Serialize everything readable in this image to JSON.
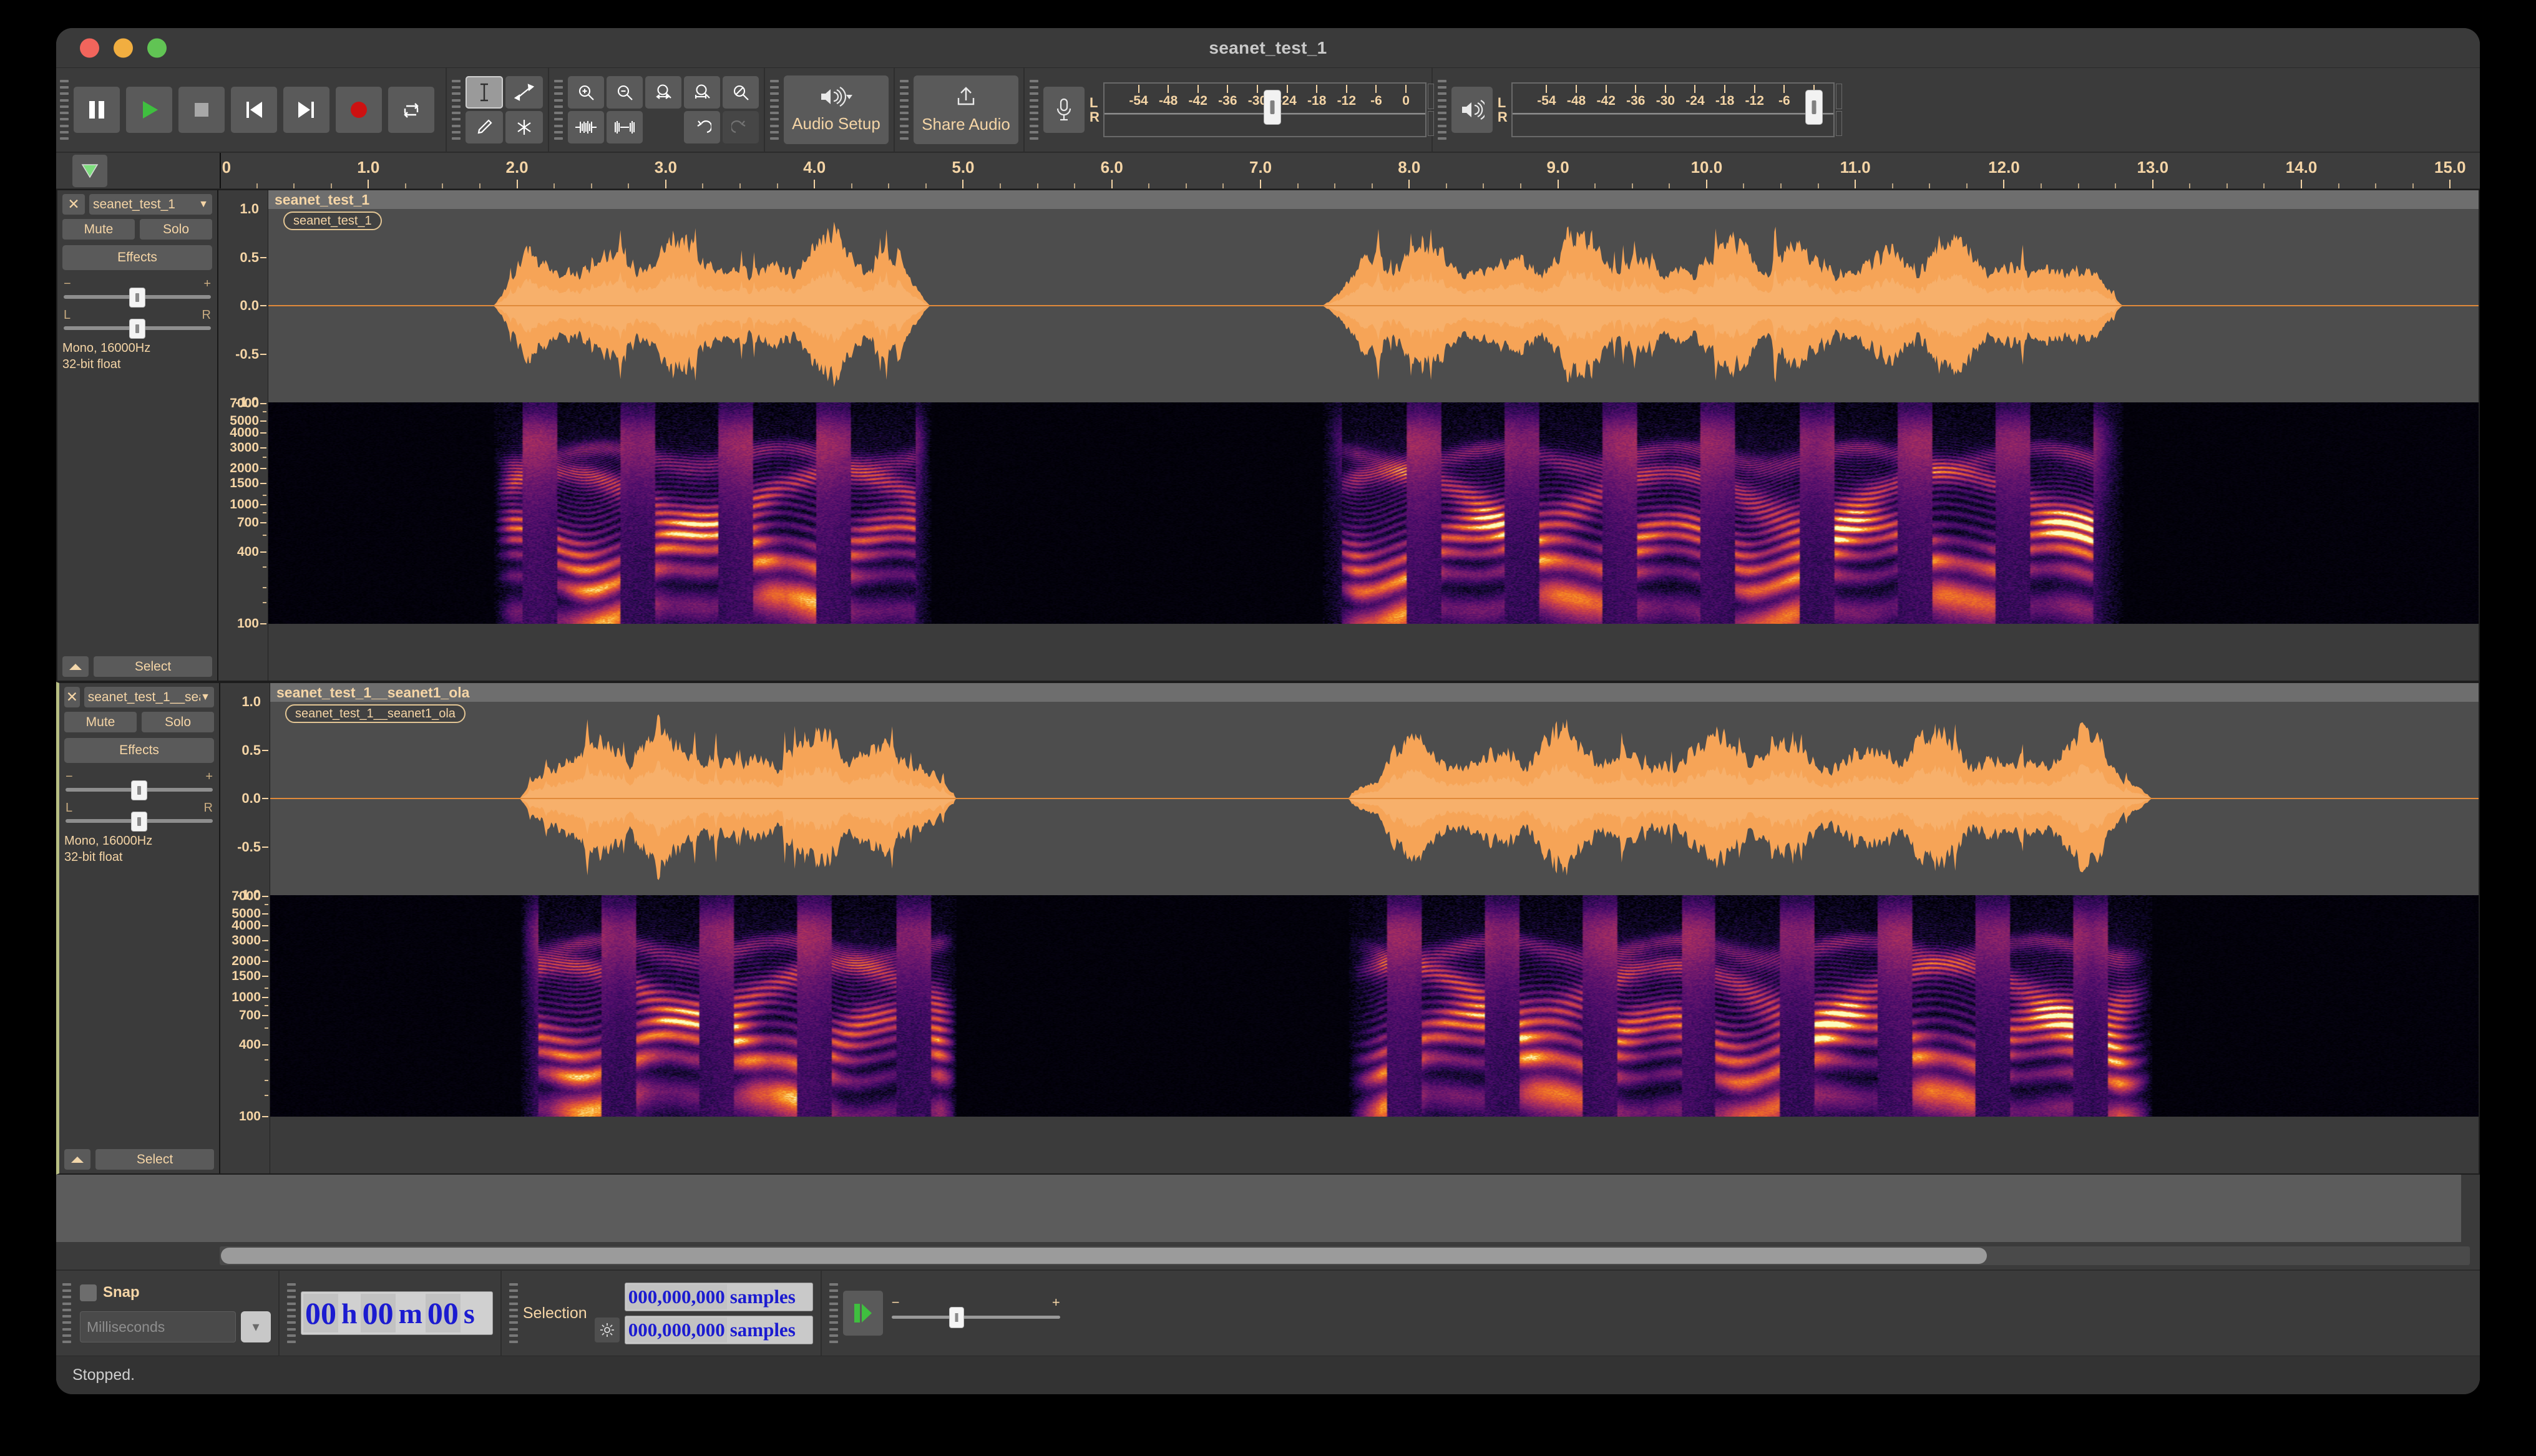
{
  "window": {
    "title": "seanet_test_1",
    "traffic_lights": [
      "close",
      "minimize",
      "zoom"
    ]
  },
  "transport": {
    "buttons": [
      {
        "name": "pause",
        "icon": "pause-icon"
      },
      {
        "name": "play",
        "icon": "play-icon"
      },
      {
        "name": "stop",
        "icon": "stop-icon"
      },
      {
        "name": "skip-to-start",
        "icon": "skip-start-icon"
      },
      {
        "name": "skip-to-end",
        "icon": "skip-end-icon"
      },
      {
        "name": "record",
        "icon": "record-icon"
      },
      {
        "name": "loop",
        "icon": "loop-icon"
      }
    ]
  },
  "tools": {
    "selection": "selection-tool",
    "envelope": "envelope-tool",
    "draw": "draw-tool",
    "multi": "multi-tool",
    "selected": "selection-tool"
  },
  "edit_tools": {
    "zoom_in": "zoom-in-icon",
    "zoom_out": "zoom-out-icon",
    "fit_selection": "fit-selection-icon",
    "fit_project": "fit-project-icon",
    "zoom_toggle": "zoom-toggle-icon",
    "trim_audio": "trim-audio-icon",
    "silence_audio": "silence-audio-icon",
    "undo": "undo-icon",
    "redo": "redo-icon"
  },
  "audio_setup": {
    "label": "Audio Setup",
    "icon": "speaker-icon"
  },
  "share_audio": {
    "label": "Share Audio",
    "icon": "upload-icon"
  },
  "recording_meter": {
    "icon": "microphone-icon",
    "left_label": "L",
    "right_label": "R",
    "ticks": [
      -54,
      -48,
      -42,
      -36,
      -30,
      -24,
      -18,
      -12,
      -6,
      0
    ],
    "slider_value_db": -27
  },
  "playback_meter": {
    "icon": "speaker-icon",
    "left_label": "L",
    "right_label": "R",
    "ticks": [
      -54,
      -48,
      -42,
      -36,
      -30,
      -24,
      -18,
      -12,
      -6,
      0
    ],
    "slider_value_db": 0
  },
  "timeline": {
    "pin_icon": "pinned-play-head-icon",
    "labels": [
      "0.0",
      "1.0",
      "2.0",
      "3.0",
      "4.0",
      "5.0",
      "6.0",
      "7.0",
      "8.0",
      "9.0",
      "10.0",
      "11.0",
      "12.0",
      "13.0",
      "14.0",
      "15.0"
    ],
    "start": 0.0,
    "end": 15.2,
    "cursor_position": 0.0
  },
  "tracks": [
    {
      "name": "seanet_test_1",
      "clip_name": "seanet_test_1",
      "close_label": "✕",
      "mute_label": "Mute",
      "solo_label": "Solo",
      "effects_label": "Effects",
      "select_label": "Select",
      "gain_minus": "−",
      "gain_plus": "+",
      "pan_left": "L",
      "pan_right": "R",
      "info_line_1": "Mono, 16000Hz",
      "info_line_2": "32-bit float",
      "wave_scale": [
        "1.0",
        "0.5",
        "0.0",
        "-0.5",
        "-1.0"
      ],
      "freq_scale": [
        "7000",
        "5000",
        "4000",
        "3000",
        "2000",
        "1500",
        "1000",
        "700",
        "400",
        "100"
      ],
      "focused": false
    },
    {
      "name": "seanet_test_1__seanet1_ola",
      "clip_name": "seanet_test_1__seanet1_ola",
      "close_label": "✕",
      "mute_label": "Mute",
      "solo_label": "Solo",
      "effects_label": "Effects",
      "select_label": "Select",
      "gain_minus": "−",
      "gain_plus": "+",
      "pan_left": "L",
      "pan_right": "R",
      "info_line_1": "Mono, 16000Hz",
      "info_line_2": "32-bit float",
      "wave_scale": [
        "1.0",
        "0.5",
        "0.0",
        "-0.5",
        "-1.0"
      ],
      "freq_scale": [
        "7000",
        "5000",
        "4000",
        "3000",
        "2000",
        "1500",
        "1000",
        "700",
        "400",
        "100"
      ],
      "focused": true
    }
  ],
  "bottom": {
    "snap_label": "Snap",
    "snap_checked": false,
    "snap_unit": "Milliseconds",
    "audio_position": {
      "hours": "00",
      "h": "h",
      "minutes": "00",
      "m": "m",
      "seconds": "00",
      "s": "s"
    },
    "selection_label": "Selection",
    "selection_start": "000,000,000",
    "selection_end": "000,000,000",
    "selection_unit": "samples",
    "gear_icon": "gear-icon",
    "play_speed_icon": "play-at-speed-icon",
    "speed_minus": "−",
    "speed_plus": "+"
  },
  "status": {
    "text": "Stopped."
  },
  "colors": {
    "accent_text": "#f5d5a6",
    "waveform": "#f5a25a",
    "play_green": "#3fbf3f",
    "record_red": "#cc1111",
    "panel_bg": "#3b3b3b",
    "button_bg": "#5a5a5a",
    "clip_header": "#6e6e6e",
    "wave_bg": "#4d4d4d",
    "digit_blue": "#1b1bd0"
  }
}
